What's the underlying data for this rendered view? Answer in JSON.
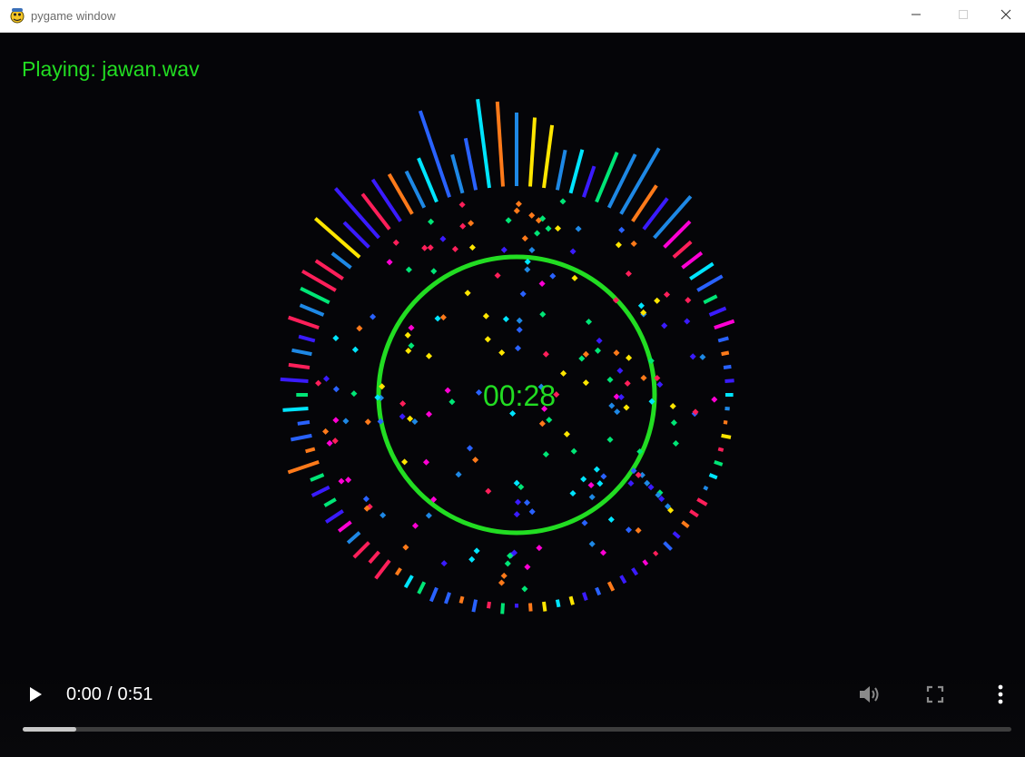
{
  "window": {
    "title": "pygame window",
    "app_icon": "pygame-snake-icon",
    "controls": [
      "minimize-icon",
      "maximize-icon",
      "close-icon"
    ]
  },
  "status": {
    "playing_text": "Playing: jawan.wav"
  },
  "visualizer": {
    "timer": "00:28",
    "ring_color": "#22dd22",
    "palette": [
      "#ff1f5a",
      "#00e676",
      "#1e88e5",
      "#2962ff",
      "#00e5ff",
      "#ff00d4",
      "#ff7a1a",
      "#ffe600",
      "#3a1bff"
    ]
  },
  "media_controls": {
    "current_time": "0:00",
    "separator": "/",
    "duration": "0:51",
    "progress_fraction": 0.054,
    "icons": [
      "play-icon",
      "volume-icon",
      "fullscreen-icon",
      "more-options-icon"
    ]
  },
  "colors": {
    "accent_green": "#22dd22",
    "background": "#050508"
  }
}
